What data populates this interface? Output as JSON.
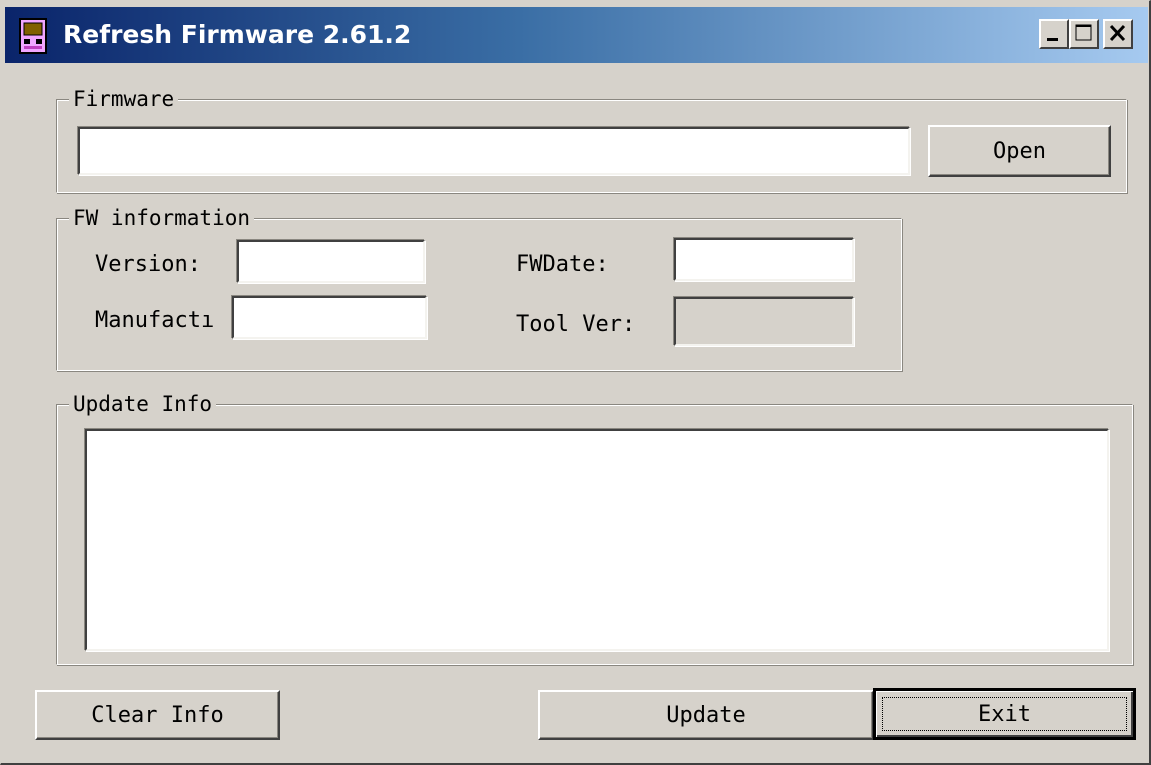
{
  "window": {
    "title": "Refresh Firmware 2.61.2",
    "controls": {
      "minimize": "minimize",
      "maximize": "maximize",
      "close": "close"
    }
  },
  "firmware_group": {
    "legend": "Firmware",
    "path_value": "",
    "open_label": "Open"
  },
  "fw_info_group": {
    "legend": "FW information",
    "version_label": "Version:",
    "version_value": "",
    "fwdate_label": "FWDate:",
    "fwdate_value": "",
    "manufacturer_label": "Manufactı",
    "manufacturer_value": "",
    "toolver_label": "Tool Ver:",
    "toolver_value": ""
  },
  "update_info_group": {
    "legend": "Update Info",
    "log_text": ""
  },
  "buttons": {
    "clear_info": "Clear Info",
    "update": "Update",
    "exit": "Exit"
  },
  "colors": {
    "title_gradient_start": "#0a246a",
    "title_gradient_end": "#a6caf0",
    "face": "#d6d2cb"
  }
}
